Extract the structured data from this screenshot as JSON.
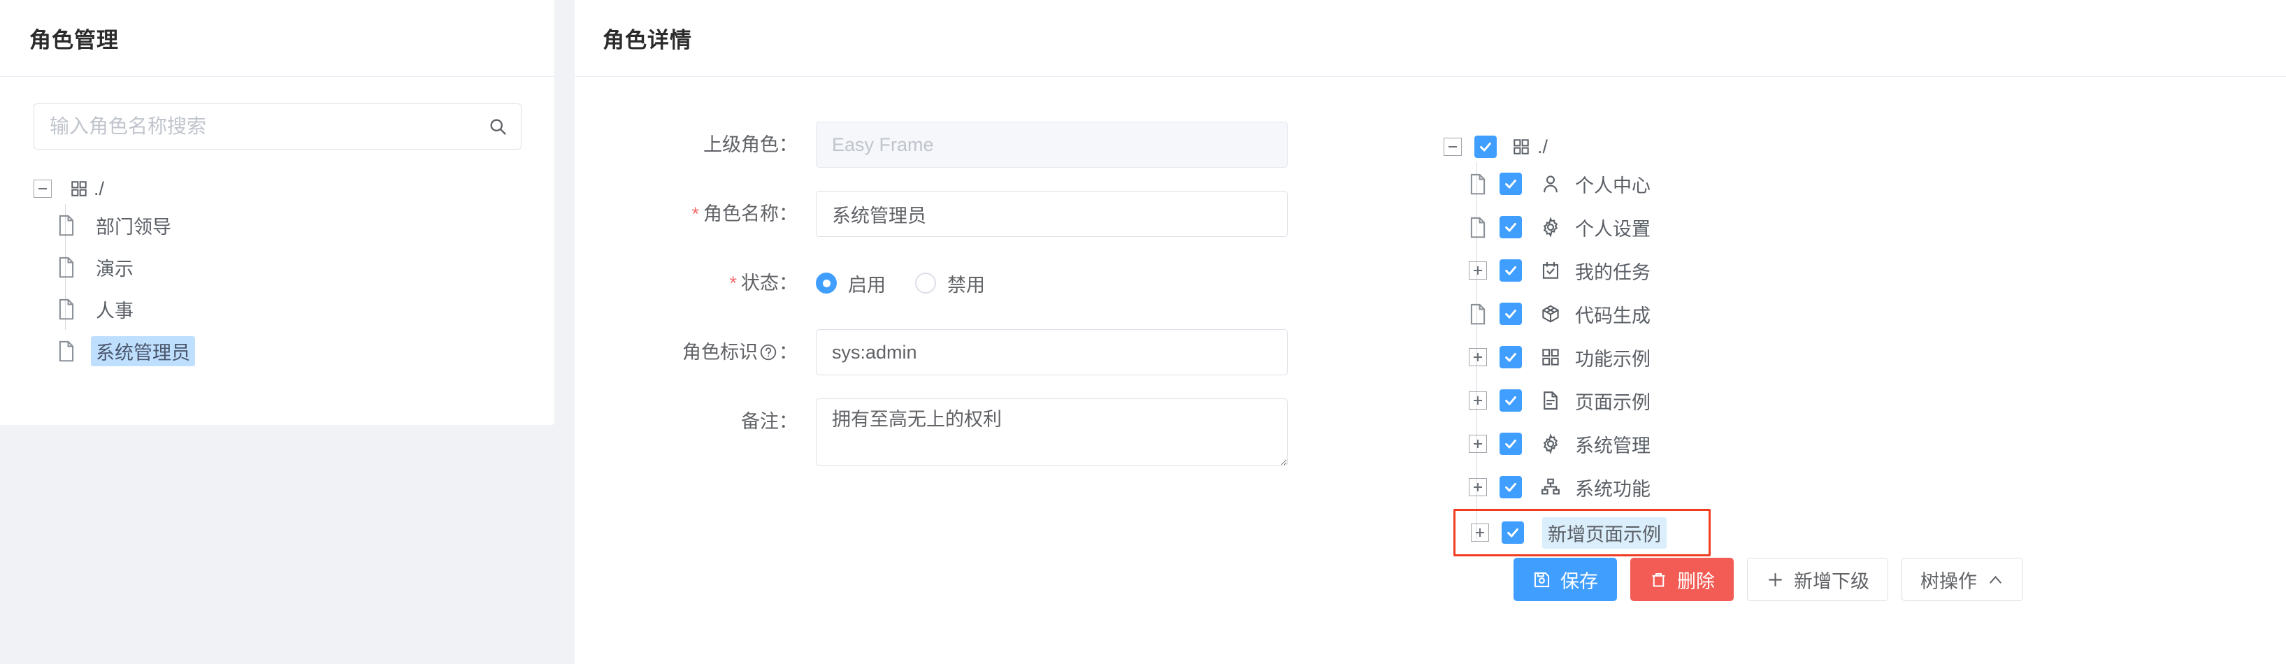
{
  "left": {
    "title": "角色管理",
    "search": {
      "placeholder": "输入角色名称搜索",
      "value": "",
      "icon": "search-icon"
    },
    "tree": {
      "root": {
        "label": "./",
        "toggle": "minus",
        "icon": "grid-icon"
      },
      "items": [
        {
          "label": "部门领导",
          "icon": "file-icon",
          "selected": false
        },
        {
          "label": "演示",
          "icon": "file-icon",
          "selected": false
        },
        {
          "label": "人事",
          "icon": "file-icon",
          "selected": false
        },
        {
          "label": "系统管理员",
          "icon": "file-icon",
          "selected": true
        }
      ]
    }
  },
  "right": {
    "title": "角色详情",
    "form": {
      "parent_role": {
        "label": "上级角色：",
        "value": "",
        "placeholder": "Easy Frame",
        "disabled": true
      },
      "role_name": {
        "label": "角色名称：",
        "required": true,
        "value": "系统管理员",
        "placeholder": ""
      },
      "status": {
        "label": "状态：",
        "required": true,
        "options": [
          {
            "label": "启用",
            "checked": true
          },
          {
            "label": "禁用",
            "checked": false
          }
        ]
      },
      "role_key": {
        "label": "角色标识",
        "label_suffix": "：",
        "help_icon": "question-circle-icon",
        "value": "sys:admin",
        "placeholder": ""
      },
      "remark": {
        "label": "备注：",
        "value": "拥有至高无上的权利",
        "placeholder": ""
      }
    },
    "buttons": [
      {
        "label": "保存",
        "icon": "save-icon",
        "style": "primary"
      },
      {
        "label": "删除",
        "icon": "trash-icon",
        "style": "danger"
      },
      {
        "label": "新增下级",
        "icon": "plus-icon",
        "style": "default"
      },
      {
        "label": "树操作",
        "icon": "chevron-up-icon",
        "style": "default"
      }
    ],
    "perm_tree": {
      "root": {
        "label": "./",
        "toggle": "minus",
        "checked": true,
        "icon": "grid-icon"
      },
      "items": [
        {
          "label": "个人中心",
          "toggle": "leaf",
          "checked": true,
          "icon": "user-icon",
          "highlight": false,
          "boxed": false
        },
        {
          "label": "个人设置",
          "toggle": "leaf",
          "checked": true,
          "icon": "gear-icon",
          "highlight": false,
          "boxed": false
        },
        {
          "label": "我的任务",
          "toggle": "plus",
          "checked": true,
          "icon": "task-check-icon",
          "highlight": false,
          "boxed": false
        },
        {
          "label": "代码生成",
          "toggle": "leaf",
          "checked": true,
          "icon": "cube-icon",
          "highlight": false,
          "boxed": false
        },
        {
          "label": "功能示例",
          "toggle": "plus",
          "checked": true,
          "icon": "grid-icon",
          "highlight": false,
          "boxed": false
        },
        {
          "label": "页面示例",
          "toggle": "plus",
          "checked": true,
          "icon": "document-icon",
          "highlight": false,
          "boxed": false
        },
        {
          "label": "系统管理",
          "toggle": "plus",
          "checked": true,
          "icon": "gear-icon",
          "highlight": false,
          "boxed": false
        },
        {
          "label": "系统功能",
          "toggle": "plus",
          "checked": true,
          "icon": "sitemap-icon",
          "highlight": false,
          "boxed": false
        },
        {
          "label": "新增页面示例",
          "toggle": "plus",
          "checked": true,
          "icon": "none",
          "highlight": true,
          "boxed": true
        }
      ]
    }
  },
  "colors": {
    "accent": "#409eff",
    "danger": "#f25c55",
    "highlight_box": "#f03c20",
    "selected_bg": "#bfdfff",
    "page_bg": "#f0f2f5"
  }
}
